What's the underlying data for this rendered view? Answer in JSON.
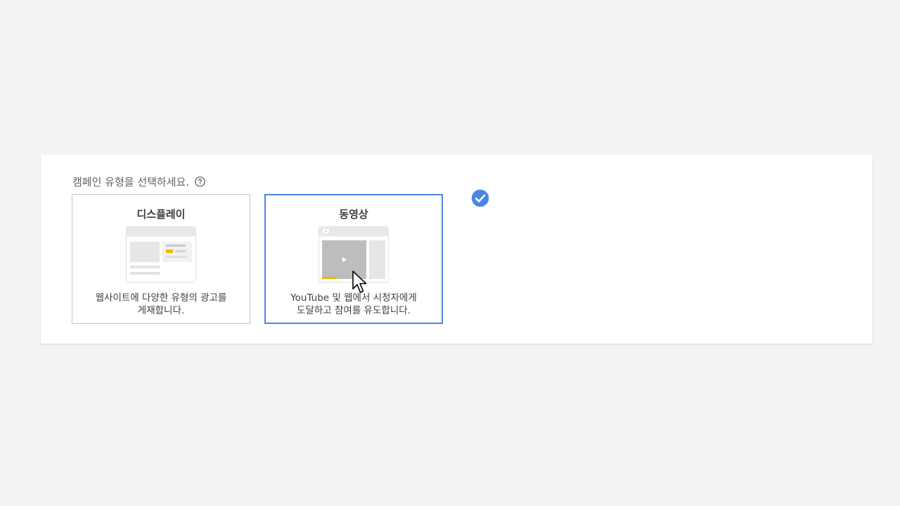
{
  "campaign": {
    "heading": "캠페인 유형을 선택하세요.",
    "options": [
      {
        "title": "디스플레이",
        "description_line1": "웹사이트에 다양한 유형의 광고를",
        "description_line2": "게재합니다.",
        "selected": false,
        "icon": "display-ad-illustration"
      },
      {
        "title": "동영상",
        "description_line1": "YouTube 및 웹에서 시청자에게",
        "description_line2": "도달하고 참여를 유도합니다.",
        "selected": true,
        "icon": "video-ad-illustration"
      }
    ]
  },
  "icons": {
    "help": "help-circle-icon",
    "check": "check-circle-icon",
    "cursor": "mouse-pointer-icon"
  },
  "colors": {
    "accent": "#4a86e8",
    "highlight": "#f4b400",
    "border": "#c6c6c6",
    "background": "#f3f3f3"
  }
}
